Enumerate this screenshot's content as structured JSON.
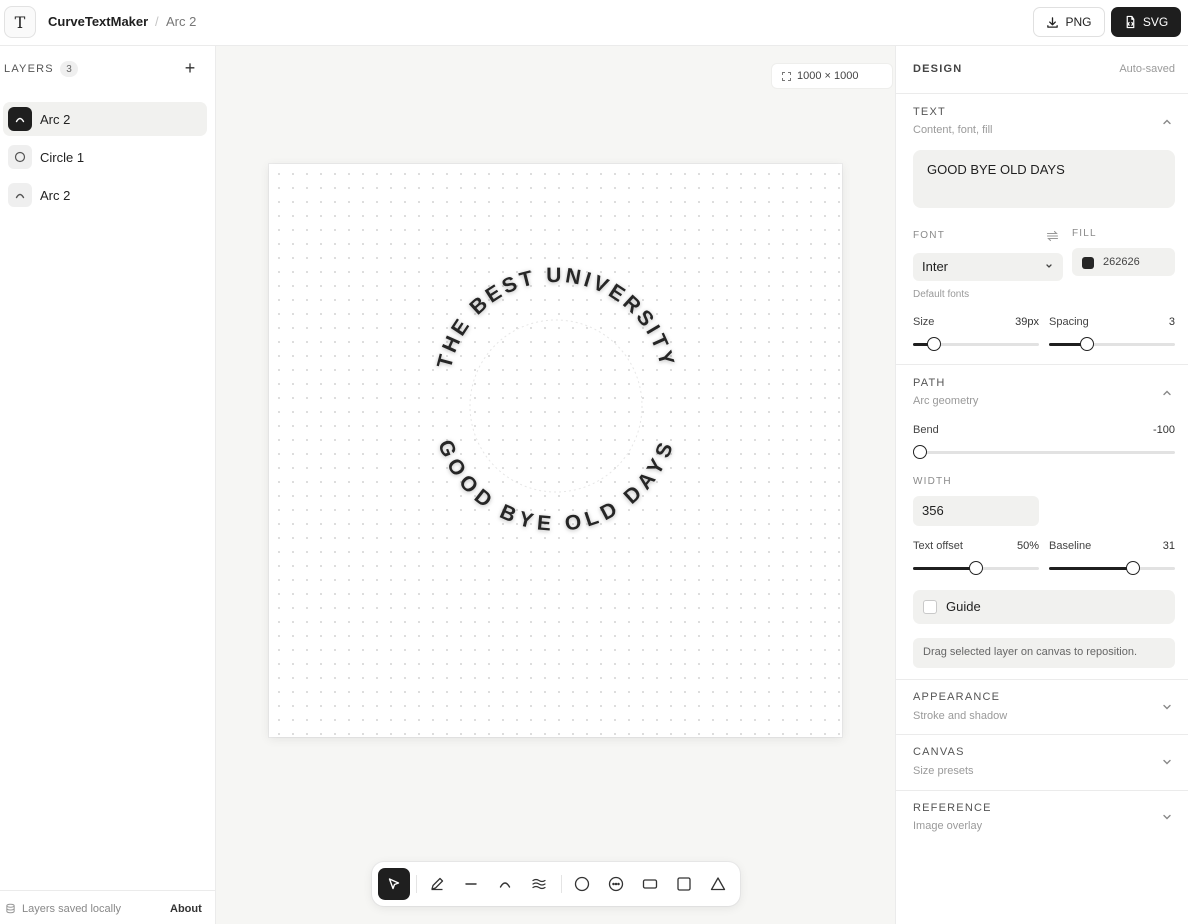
{
  "app": {
    "name": "CurveTextMaker",
    "crumb_sep": "/",
    "crumb": "Arc 2",
    "logo_glyph": "T"
  },
  "export": {
    "png_label": "PNG",
    "svg_label": "SVG"
  },
  "layers": {
    "title": "LAYERS",
    "count": "3",
    "add_glyph": "+",
    "items": [
      {
        "label": "Arc 2",
        "icon": "arc-icon",
        "active": true
      },
      {
        "label": "Circle 1",
        "icon": "circle-icon",
        "active": false
      },
      {
        "label": "Arc 2",
        "icon": "arc-icon",
        "active": false
      }
    ],
    "footer_text": "Layers saved locally",
    "about_label": "About"
  },
  "canvas": {
    "size_label": "1000 × 1000",
    "top_text": "THE BEST UNIVERSITY",
    "bottom_text": "GOOD BYE OLD DAYS",
    "text_color": "#262626",
    "background": "#f6f6f4"
  },
  "toolbar": {
    "tools": [
      "select-tool",
      "pen-tool",
      "line-tool",
      "arc-tool",
      "wave-tool",
      "circle-tool",
      "dotted-circle-tool",
      "ellipse-tool",
      "square-tool",
      "triangle-tool"
    ],
    "active": "select-tool"
  },
  "design": {
    "title": "DESIGN",
    "saved": "Auto-saved",
    "text_section": {
      "title": "TEXT",
      "subtitle": "Content, font, fill",
      "content": "GOOD BYE OLD DAYS",
      "font_label": "FONT",
      "font_value": "Inter",
      "fill_label": "FILL",
      "fill_hex": "262626",
      "fill_color": "#262626",
      "font_hint": "Default fonts",
      "size_label": "Size",
      "size_value": "39px",
      "size_fraction": 0.17,
      "spacing_label": "Spacing",
      "spacing_value": "3",
      "spacing_fraction": 0.3
    },
    "path_section": {
      "title": "PATH",
      "subtitle": "Arc geometry",
      "bend_label": "Bend",
      "bend_value": "-100",
      "bend_fraction": 0.0,
      "width_label": "WIDTH",
      "width_value": "356",
      "offset_label": "Text offset",
      "offset_value": "50%",
      "offset_fraction": 0.5,
      "baseline_label": "Baseline",
      "baseline_value": "31",
      "baseline_fraction": 0.67,
      "guide_label": "Guide",
      "guide_checked": false,
      "note": "Drag selected layer on canvas to reposition."
    },
    "appearance": {
      "title": "APPEARANCE",
      "subtitle": "Stroke and shadow"
    },
    "canvas_section": {
      "title": "CANVAS",
      "subtitle": "Size presets"
    },
    "reference": {
      "title": "REFERENCE",
      "subtitle": "Image overlay"
    }
  }
}
